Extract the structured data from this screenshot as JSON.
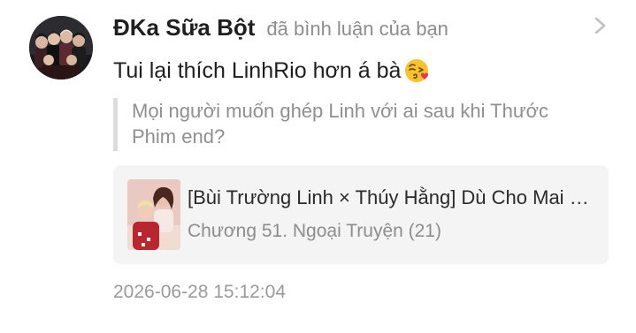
{
  "notification": {
    "username": "ĐKa Sữa Bột",
    "action": "đã bình luận của bạn",
    "comment": "Tui lại thích LinhRio hơn á bà",
    "emoji": "face-blowing-kiss-icon",
    "quoted_comment": "Mọi người muốn ghép Linh với ai sau khi Thước Phim end?",
    "story": {
      "title": "[Bùi Trường Linh × Thúy Hằng] Dù Cho Mai Về Sau",
      "chapter": "Chương 51. Ngoại Truyện (21)"
    },
    "timestamp": "2026-06-28 15:12:04"
  },
  "colors": {
    "background": "#ffffff",
    "username": "#1f1f1f",
    "muted_text": "#8d8d8d",
    "quote_bar": "#dcdcdc",
    "card_background": "#f4f4f4"
  },
  "icons": {
    "chevron": "chevron-right-icon",
    "avatar": "user-avatar",
    "thumbnail": "story-cover-thumbnail"
  }
}
